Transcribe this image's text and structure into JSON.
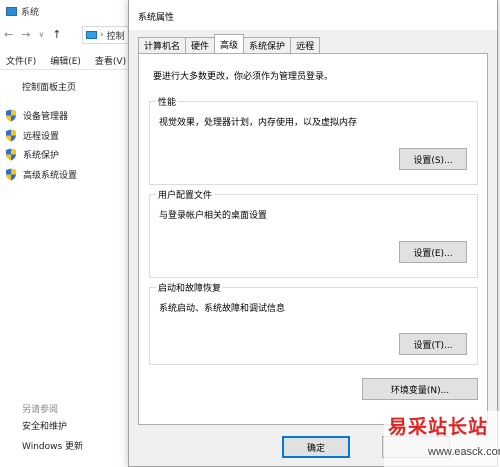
{
  "bg_window": {
    "title": "系统",
    "address": "控制",
    "menu": [
      "文件(F)",
      "编辑(E)",
      "查看(V)"
    ],
    "home_link": "控制面板主页",
    "links": [
      "设备管理器",
      "远程设置",
      "系统保护",
      "高级系统设置"
    ],
    "see_also_heading": "另请参阅",
    "see_also": [
      "安全和维护",
      "Windows 更新"
    ]
  },
  "dialog": {
    "title": "系统属性",
    "tabs": [
      "计算机名",
      "硬件",
      "高级",
      "系统保护",
      "远程"
    ],
    "active_tab": "高级",
    "intro": "要进行大多数更改，你必须作为管理员登录。",
    "performance": {
      "legend": "性能",
      "desc": "视觉效果，处理器计划，内存使用，以及虚拟内存",
      "button": "设置(S)..."
    },
    "user_profiles": {
      "legend": "用户配置文件",
      "desc": "与登录帐户相关的桌面设置",
      "button": "设置(E)..."
    },
    "startup_recovery": {
      "legend": "启动和故障恢复",
      "desc": "系统启动、系统故障和调试信息",
      "button": "设置(T)..."
    },
    "env_button": "环境变量(N)...",
    "ok_button": "确定"
  },
  "watermark": {
    "cn": "易采站长站",
    "en": "www.easck.com"
  },
  "colors": {
    "accent": "#0078d7",
    "shield_blue": "#2e6fd6",
    "shield_yellow": "#f5c518",
    "watermark_red": "#e02424"
  }
}
